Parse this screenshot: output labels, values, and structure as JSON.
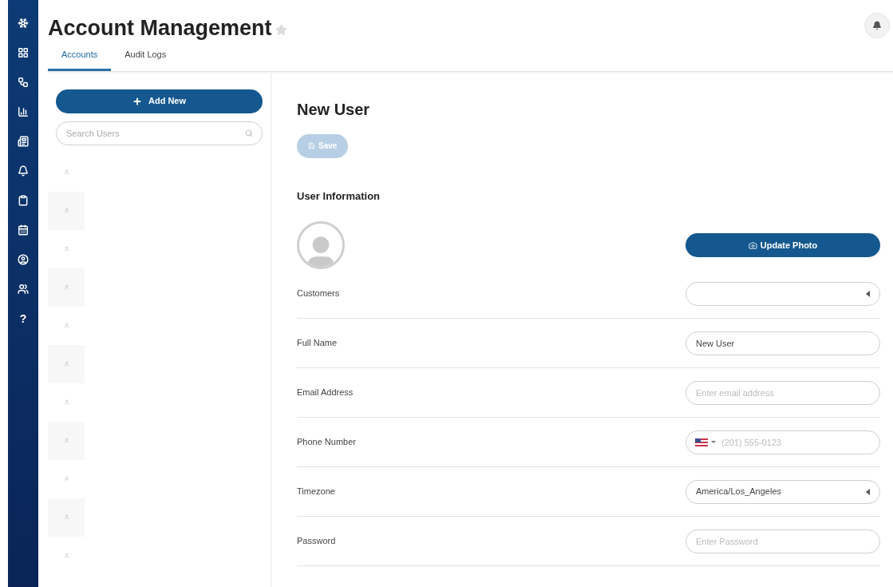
{
  "sidebar": {
    "help_label": "?"
  },
  "header": {
    "title": "Account Management",
    "favorite": false
  },
  "tabs": [
    {
      "label": "Accounts",
      "selected": true
    },
    {
      "label": "Audit Logs",
      "selected": false
    }
  ],
  "users_panel": {
    "add_button": "Add New",
    "search": {
      "placeholder": "Search Users"
    }
  },
  "detail": {
    "title": "New User",
    "save_button": {
      "label": "Save",
      "disabled": true
    },
    "section_title": "User Information",
    "update_photo_button": "Update Photo",
    "fields": [
      {
        "label": "Customers",
        "kind": "select"
      },
      {
        "label": "Full Name",
        "kind": "text",
        "value": "New User"
      },
      {
        "label": "Email Address",
        "kind": "text",
        "placeholder": "Enter email address"
      },
      {
        "label": "Phone Number",
        "kind": "phone",
        "placeholder": "(201) 555-0123"
      },
      {
        "label": "Timezone",
        "kind": "select",
        "value": "America/Los_Angeles"
      },
      {
        "label": "Password",
        "kind": "text",
        "placeholder": "Enter Password"
      }
    ]
  }
}
